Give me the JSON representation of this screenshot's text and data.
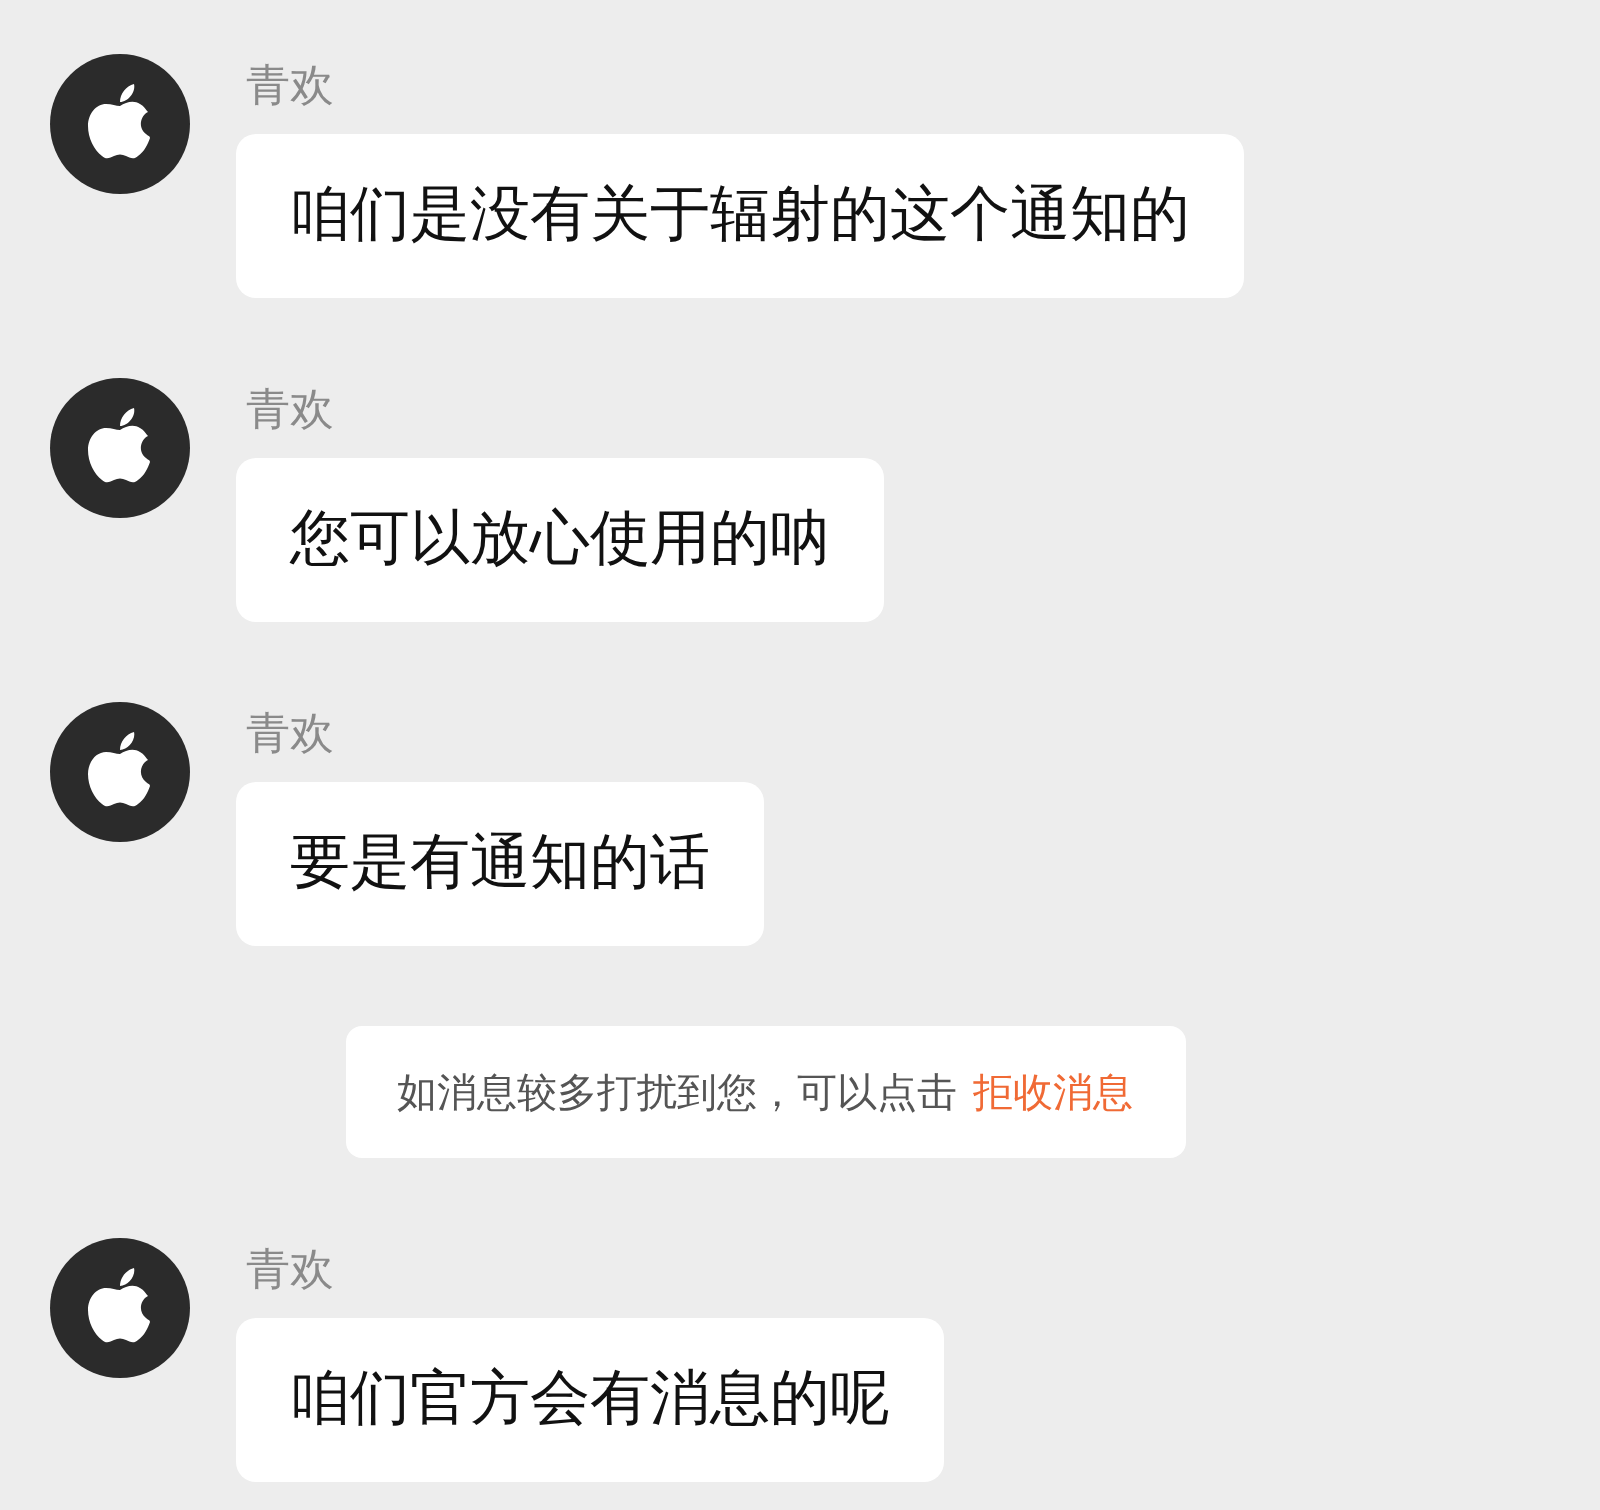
{
  "chat": [
    {
      "kind": "message",
      "sender": "青欢",
      "text": "咱们是没有关于辐射的这个通知的"
    },
    {
      "kind": "message",
      "sender": "青欢",
      "text": "您可以放心使用的呐"
    },
    {
      "kind": "message",
      "sender": "青欢",
      "text": "要是有通知的话"
    },
    {
      "kind": "notice",
      "text": "如消息较多打扰到您，可以点击",
      "link": "拒收消息"
    },
    {
      "kind": "message",
      "sender": "青欢",
      "text": "咱们官方会有消息的呢"
    }
  ]
}
